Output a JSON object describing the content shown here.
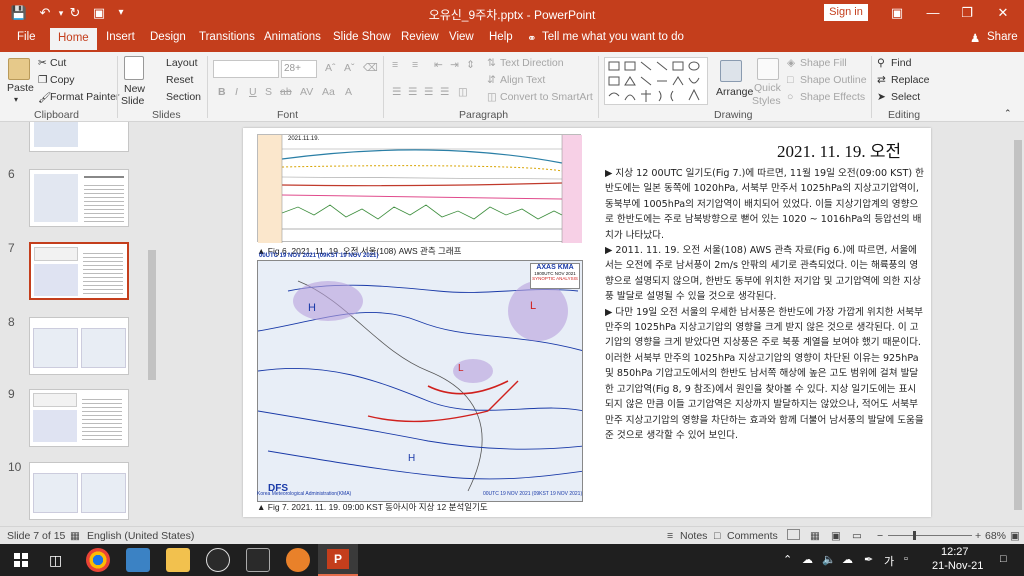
{
  "titlebar": {
    "filename": "오유신_9주차.pptx",
    "separator": " - ",
    "app": "PowerPoint",
    "signin": "Sign in",
    "accent": "#c43e1c"
  },
  "tabs": [
    "File",
    "Home",
    "Insert",
    "Design",
    "Transitions",
    "Animations",
    "Slide Show",
    "Review",
    "View",
    "Help"
  ],
  "tell_me": "Tell me what you want to do",
  "share": "Share",
  "ribbon": {
    "clipboard": {
      "paste": "Paste",
      "cut": "Cut",
      "copy": "Copy",
      "format_painter": "Format Painter",
      "label": "Clipboard"
    },
    "slides": {
      "new_slide_1": "New",
      "new_slide_2": "Slide",
      "layout": "Layout",
      "reset": "Reset",
      "section": "Section",
      "label": "Slides"
    },
    "font": {
      "size": "28+",
      "label": "Font"
    },
    "paragraph": {
      "text_direction": "Text Direction",
      "align_text": "Align Text",
      "convert_smartart": "Convert to SmartArt",
      "label": "Paragraph"
    },
    "drawing": {
      "arrange": "Arrange",
      "quick_styles_1": "Quick",
      "quick_styles_2": "Styles",
      "shape_fill": "Shape Fill",
      "shape_outline": "Shape Outline",
      "shape_effects": "Shape Effects",
      "label": "Drawing"
    },
    "editing": {
      "find": "Find",
      "replace": "Replace",
      "select": "Select",
      "label": "Editing"
    }
  },
  "thumbnails": [
    {
      "num": "",
      "selected": false
    },
    {
      "num": "6",
      "selected": false
    },
    {
      "num": "7",
      "selected": true
    },
    {
      "num": "8",
      "selected": false
    },
    {
      "num": "9",
      "selected": false
    },
    {
      "num": "10",
      "selected": false
    }
  ],
  "slide": {
    "date_title": "2021. 11. 19. 오전",
    "fig6_caption": "▲ Fig 6. 2021. 11. 19. 오전 서울(108) AWS 관측 그래프",
    "fig7_caption": "▲ Fig 7. 2021. 11. 19. 09:00 KST 동아시아 지상 12 분석일기도",
    "aws_header": "2021.11.19.",
    "map_header": "00UTC 19 NOV 2021 (09KST 19 NOV 2021)",
    "map_logo_1": "AXAS KMA",
    "map_logo_2": "1900UTC NOV 2021",
    "map_logo_3": "SYNOPTIC ANALYSIS",
    "map_footer_left": "Korea Meteorological Administration(KMA)",
    "map_footer_right": "00UTC 19 NOV 2021 (09KST 19 NOV 2021)",
    "map_dfs": "DFS",
    "paragraphs": [
      "▶ 지상 12 00UTC 일기도(Fig 7.)에 따르면, 11월 19일 오전(09:00 KST) 한반도에는 일본 동쪽에 1020hPa, 서북부 만주서 1025hPa의 지상고기압역이, 동북부에 1005hPa의 저기압역이 배치되어 있었다. 이들 지상기압계의 영향으로 한반도에는 주로 남북방향으로 뻗어 있는 1020 ~ 1016hPa의 등압선의 배치가 나타났다.",
      "▶ 2011. 11. 19. 오전 서울(108) AWS 관측 자료(Fig 6.)에 따르면, 서울에서는 오전에 주로 남서풍이 2m/s 안팎의 세기로 관측되었다. 이는 해륙풍의 영향으로 설명되지 않으며, 한반도 동부에 위치한 저기압 및 고기압역에 의한 지상풍 발달로 설명될 수 있을 것으로 생각된다.",
      "▶ 다만 19일 오전 서울의 우세한 남서풍은 한반도에 가장 가깝게 위치한 서북부 만주의 1025hPa 지상고기압의 영향을 크게 받지 않은 것으로 생각된다. 이 고기압의 영향을 크게 받았다면 지상풍은 주로 북풍 계열을 보여야 했기 때문이다. 이러한 서북부 만주의 1025hPa 지상고기압의 영향이 차단된 이유는 925hPa 및 850hPa 기압고도에서의 한반도 남서쪽 해상에 높은 고도 범위에 걸쳐 발달한 고기압역(Fig 8, 9 참조)에서 원인을 찾아볼 수 있다. 지상 일기도에는 표시되지 않은 만큼 이들 고기압역은 지상까지 발달하지는 않았으나, 적어도 서북부 만주 지상고기압의 영향을 차단하는 효과와 함께 더불어 남서풍의 발달에 도움을 준 것으로 생각할 수 있어 보인다."
    ]
  },
  "statusbar": {
    "slide_info": "Slide 7 of 15",
    "language": "English (United States)",
    "notes": "Notes",
    "comments": "Comments",
    "zoom_minus": "−",
    "zoom_plus": "+",
    "zoom": "68%"
  },
  "taskbar": {
    "lang": "가",
    "time": "12:27",
    "date": "21-Nov-21"
  }
}
